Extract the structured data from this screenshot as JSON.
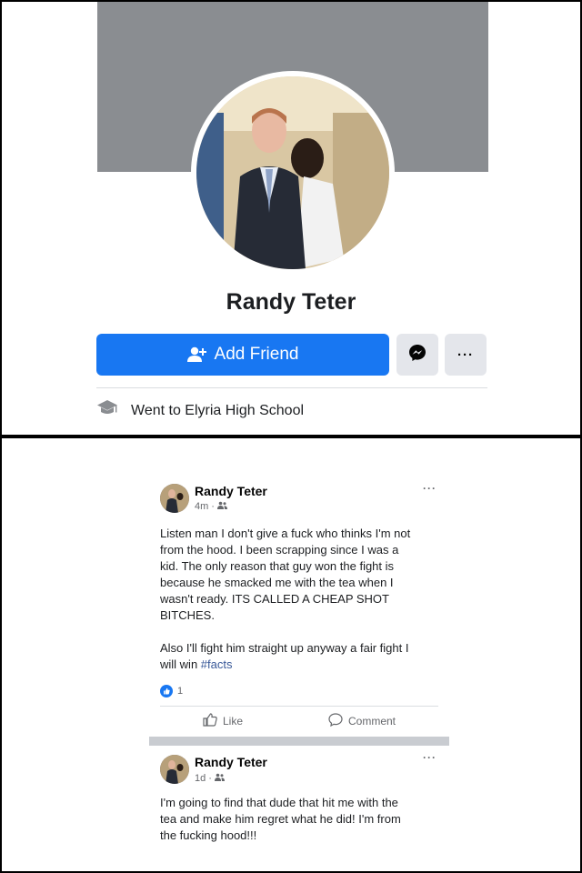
{
  "profile": {
    "name": "Randy Teter",
    "add_friend_label": "Add Friend",
    "more_label": "···",
    "education": "Went to Elyria High School"
  },
  "posts": [
    {
      "author": "Randy Teter",
      "time": "4m",
      "paragraph1": "Listen man I don't give a fuck who thinks I'm not\nfrom the hood. I been scrapping since I was a\nkid. The only reason that guy won the fight is\nbecause he smacked me with the tea when I\nwasn't ready. ITS CALLED A CHEAP SHOT\nBITCHES.",
      "paragraph2": "Also I'll fight him straight up anyway a fair fight I\nwill win ",
      "hashtag": "#facts",
      "reaction_count": "1",
      "like_label": "Like",
      "comment_label": "Comment",
      "more_label": "···"
    },
    {
      "author": "Randy Teter",
      "time": "1d",
      "text": "I'm going to find that dude that hit me with the\ntea and make him regret what he did! I'm from\nthe fucking hood!!!",
      "more_label": "···"
    }
  ],
  "colors": {
    "accent": "#1877f2",
    "cover": "#8a8d91",
    "secondary_button": "#e4e6eb",
    "muted_text": "#65676b",
    "hashtag": "#385898"
  },
  "icons": {
    "add_friend": "person-plus-icon",
    "messenger": "messenger-icon",
    "education": "graduation-cap-icon",
    "audience": "friends-icon",
    "like": "thumbs-up-icon",
    "comment": "comment-bubble-icon"
  }
}
